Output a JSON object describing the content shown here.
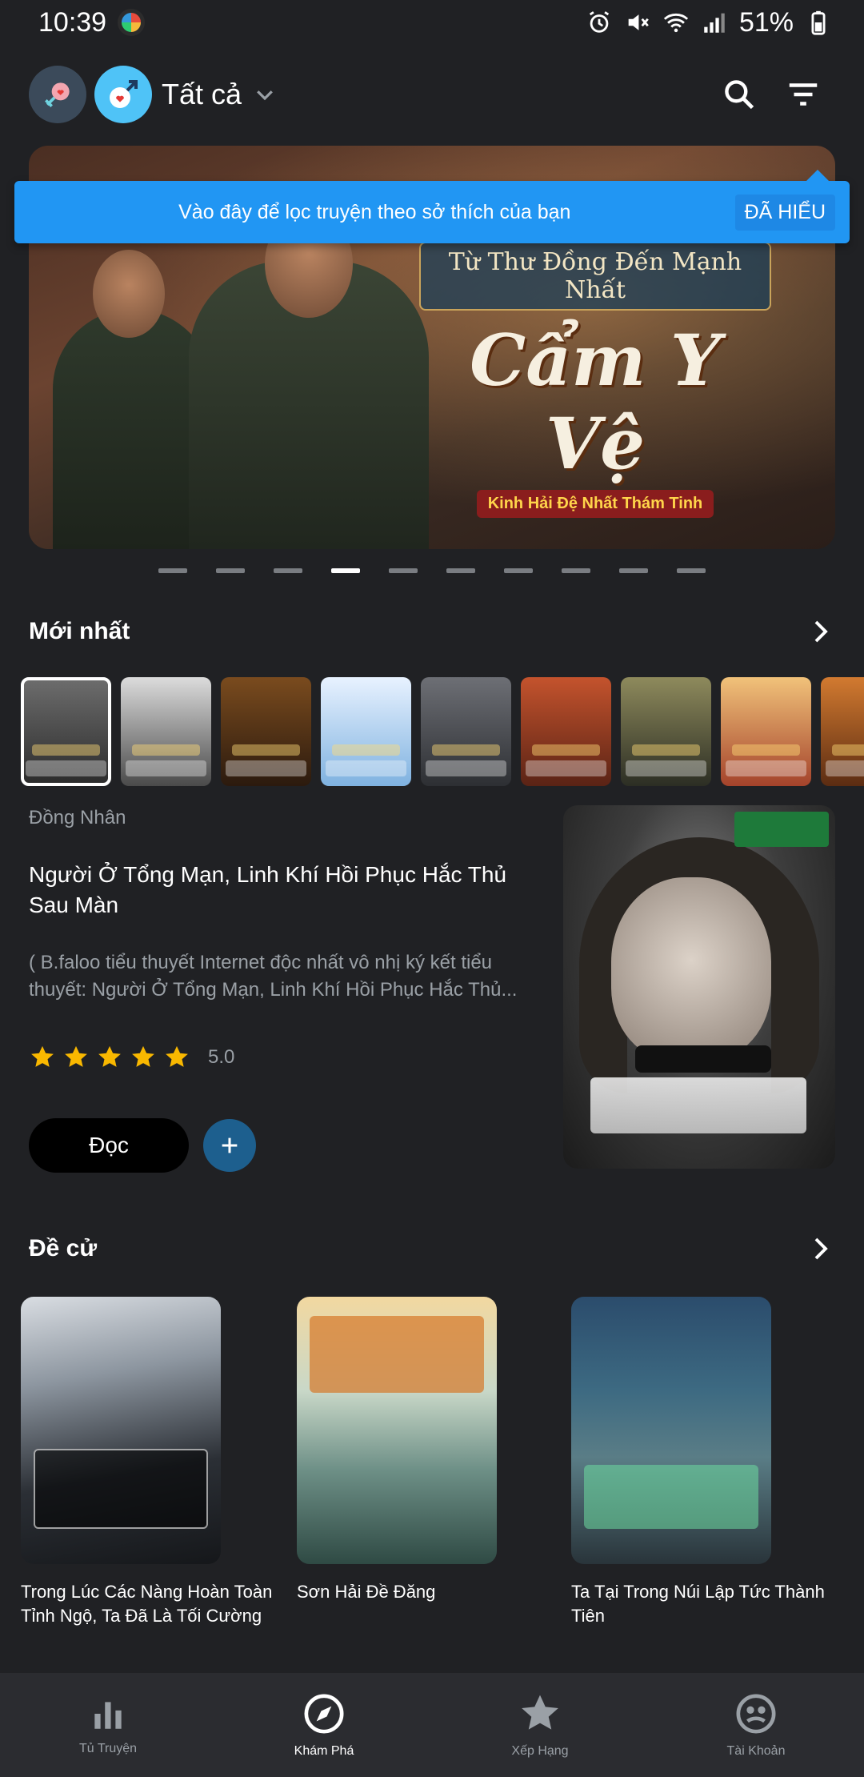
{
  "status_bar": {
    "time": "10:39",
    "battery": "51%",
    "icons": [
      "alarm-icon",
      "mute-icon",
      "wifi-icon",
      "signal-icon",
      "battery-icon"
    ]
  },
  "top_bar": {
    "filter_label": "Tất cả",
    "icons": [
      "gender-female-heart-icon",
      "gender-male-heart-icon",
      "chevron-down-icon",
      "search-icon",
      "filter-icon"
    ]
  },
  "tooltip": {
    "message": "Vào đây để lọc truyện theo sở thích của bạn",
    "dismiss_label": "ĐÃ HIỂU"
  },
  "banner": {
    "subtitle": "Từ Thư Đồng Đến Mạnh Nhất",
    "title": "Cẩm Y Vệ",
    "tagline": "Kinh Hải Đệ Nhất Thám Tinh",
    "pages": 10,
    "active_page": 4
  },
  "newest": {
    "title": "Mới nhất",
    "selected_index": 0,
    "thumb_count": 9,
    "featured": {
      "category": "Đồng Nhân",
      "title": "Người Ở Tổng Mạn, Linh Khí Hồi Phục Hắc Thủ Sau Màn",
      "description": "( B.faloo tiểu thuyết Internet độc nhất vô nhị ký kết tiểu thuyết: Người Ở Tổng Mạn, Linh Khí Hồi Phục Hắc Thủ...",
      "rating": "5.0",
      "stars": 5,
      "read_label": "Đọc"
    }
  },
  "recommend": {
    "title": "Đề cử",
    "items": [
      {
        "title": "Trong Lúc Các Nàng Hoàn Toàn Tỉnh Ngộ, Ta Đã Là Tối Cường ..."
      },
      {
        "title": "Sơn Hải Đề Đăng"
      },
      {
        "title": "Ta Tại Trong Núi Lập Tức Thành Tiên"
      }
    ]
  },
  "bottom_nav": {
    "items": [
      {
        "label": "Tủ Truyện",
        "icon": "bar-chart-icon"
      },
      {
        "label": "Khám Phá",
        "icon": "compass-icon"
      },
      {
        "label": "Xếp Hạng",
        "icon": "star-icon"
      },
      {
        "label": "Tài Khoản",
        "icon": "account-icon"
      }
    ],
    "active_index": 1
  },
  "colors": {
    "background": "#202124",
    "tooltip": "#2196f3",
    "star": "#f9b800",
    "add_button": "#1d5f8e"
  }
}
